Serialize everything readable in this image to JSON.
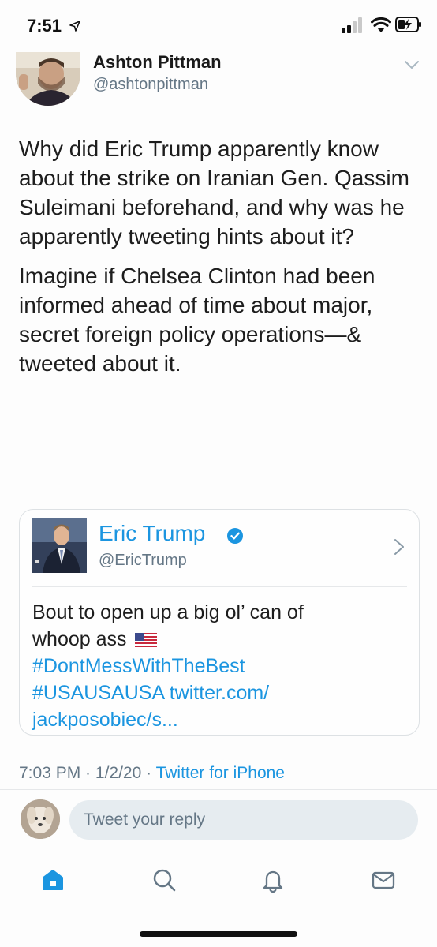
{
  "status_bar": {
    "time": "7:51"
  },
  "author": {
    "name": "Ashton Pittman",
    "handle": "@ashtonpittman"
  },
  "tweet": {
    "paragraph_1": "Why did Eric Trump apparently know about the strike on Iranian Gen. Qassim Suleimani beforehand, and why was he apparently tweeting hints about it?",
    "paragraph_2": "Imagine if Chelsea Clinton had been informed ahead of time about major, secret foreign policy operations—& tweeted about it."
  },
  "quoted_tweet": {
    "name": "Eric Trump",
    "handle": "@EricTrump",
    "text_line_1": "Bout to open up a big ol’ can of",
    "text_line_2": "whoop ass",
    "flag_icon": "us-flag-icon",
    "hashtag_1": "#DontMessWithTheBest",
    "hashtag_2": "#USAUSAUSA",
    "link_1": "twitter.com/",
    "link_2": "jackposobiec/s..."
  },
  "meta": {
    "time": "7:03 PM",
    "date": "1/2/20",
    "source": "Twitter for iPhone"
  },
  "reply": {
    "placeholder": "Tweet your reply"
  },
  "tabs": [
    "home-icon",
    "search-icon",
    "notifications-icon",
    "messages-icon"
  ],
  "colors": {
    "accent": "#1b95e0",
    "secondary_text": "#657786",
    "reply_bg": "#e6ecf0"
  }
}
